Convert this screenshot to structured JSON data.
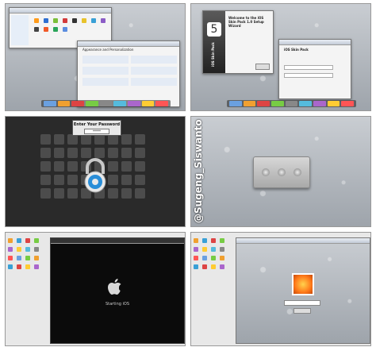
{
  "panels": {
    "p1": {
      "window_title": "",
      "center_window": "Appearance and Personalization"
    },
    "p2": {
      "installer_title": "Welcome to the iOS Skin Pack 1.0 Setup Wizard",
      "installer_badge": "5",
      "installer_caption": "iOS Skin Pack",
      "side_dialog_title": "iOS Skin Pack"
    },
    "p3": {
      "password_title": "Enter Your Password",
      "password_value": "*****"
    },
    "p4": {
      "watermark": "@Sugeng_Siswanto"
    },
    "p5": {
      "boot_text": "Starting iOS"
    },
    "p6": {}
  },
  "colors": {
    "accent_blue": "#2f6fd1",
    "dock": "#333333",
    "dark_bg": "#1c1c1c",
    "lock_blue": "#2a8ed8"
  },
  "icons": [
    "apple-logo-icon",
    "padlock-icon",
    "user-avatar-icon",
    "dock-icons"
  ]
}
